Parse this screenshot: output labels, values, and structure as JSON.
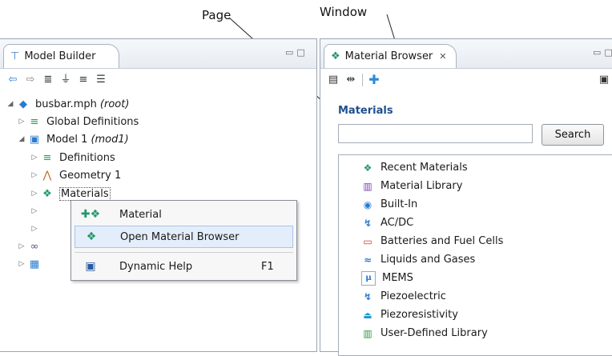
{
  "callouts": {
    "page": "Page",
    "window": "Window"
  },
  "model_builder": {
    "tab_title": "Model Builder",
    "toolbar_icons": [
      "back-arrow-icon",
      "forward-arrow-icon",
      "show-icon",
      "filter-icon",
      "expand-icon",
      "collapse-icon"
    ],
    "tree": {
      "root": {
        "label": "busbar.mph",
        "note": "(root)"
      },
      "global_definitions": "Global Definitions",
      "model": {
        "label": "Model 1",
        "note": "(mod1)"
      },
      "definitions": "Definitions",
      "geometry": "Geometry 1",
      "materials": "Materials"
    }
  },
  "context_menu": {
    "items": [
      {
        "label": "Material",
        "shortcut": ""
      },
      {
        "label": "Open Material Browser",
        "shortcut": ""
      },
      {
        "label": "Dynamic Help",
        "shortcut": "F1"
      }
    ]
  },
  "material_browser": {
    "tab_title": "Material Browser",
    "section_title": "Materials",
    "search": {
      "value": "",
      "button_label": "Search"
    },
    "libraries": [
      "Recent Materials",
      "Material Library",
      "Built-In",
      "AC/DC",
      "Batteries and Fuel Cells",
      "Liquids and Gases",
      "MEMS",
      "Piezoelectric",
      "Piezoresistivity",
      "User-Defined Library"
    ]
  },
  "colors": {
    "section_title": "#1e4f8f",
    "highlight": "#e4eefb",
    "accent": "#2a7bd0"
  }
}
